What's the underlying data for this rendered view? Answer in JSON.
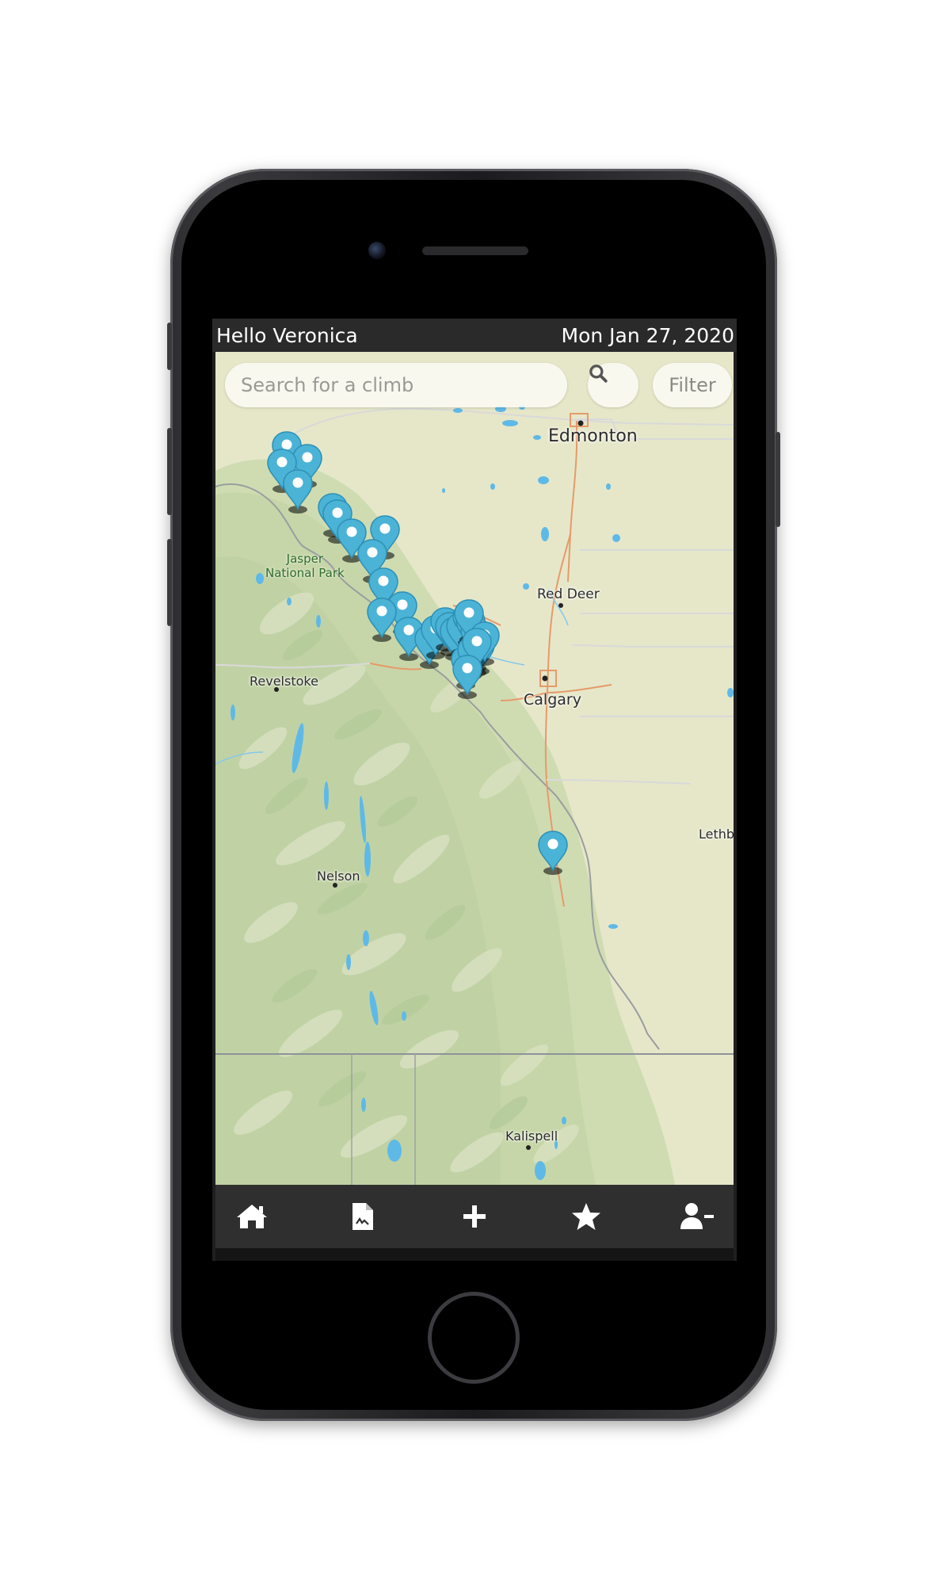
{
  "status_bar": {
    "greeting": "Hello Veronica",
    "date": "Mon Jan 27, 2020"
  },
  "search": {
    "placeholder": "Search for a climb",
    "search_icon": "search-icon",
    "filter_label": "Filter"
  },
  "map": {
    "labels": {
      "edmonton": "Edmonton",
      "red_deer": "Red Deer",
      "calgary": "Calgary",
      "revelstoke": "Revelstoke",
      "nelson": "Nelson",
      "lethbridge": "Lethb",
      "kalispell": "Kalispell",
      "jasper_line1": "Jasper",
      "jasper_line2": "National Park"
    },
    "marker_icon": "map-pin-icon",
    "marker_color": "#4ab3d6",
    "marker_count": 31
  },
  "tab_bar": {
    "items": [
      {
        "name": "home",
        "icon": "home-icon"
      },
      {
        "name": "logbook",
        "icon": "document-icon"
      },
      {
        "name": "add",
        "icon": "plus-icon"
      },
      {
        "name": "favorites",
        "icon": "star-icon"
      },
      {
        "name": "profile",
        "icon": "user-minus-icon"
      }
    ]
  },
  "colors": {
    "status_bar_bg": "#2a2a2a",
    "tab_bar_bg": "#2f2f2f",
    "marker": "#4ab3d6",
    "water": "#5fb9e6",
    "road": "#e8925a"
  }
}
